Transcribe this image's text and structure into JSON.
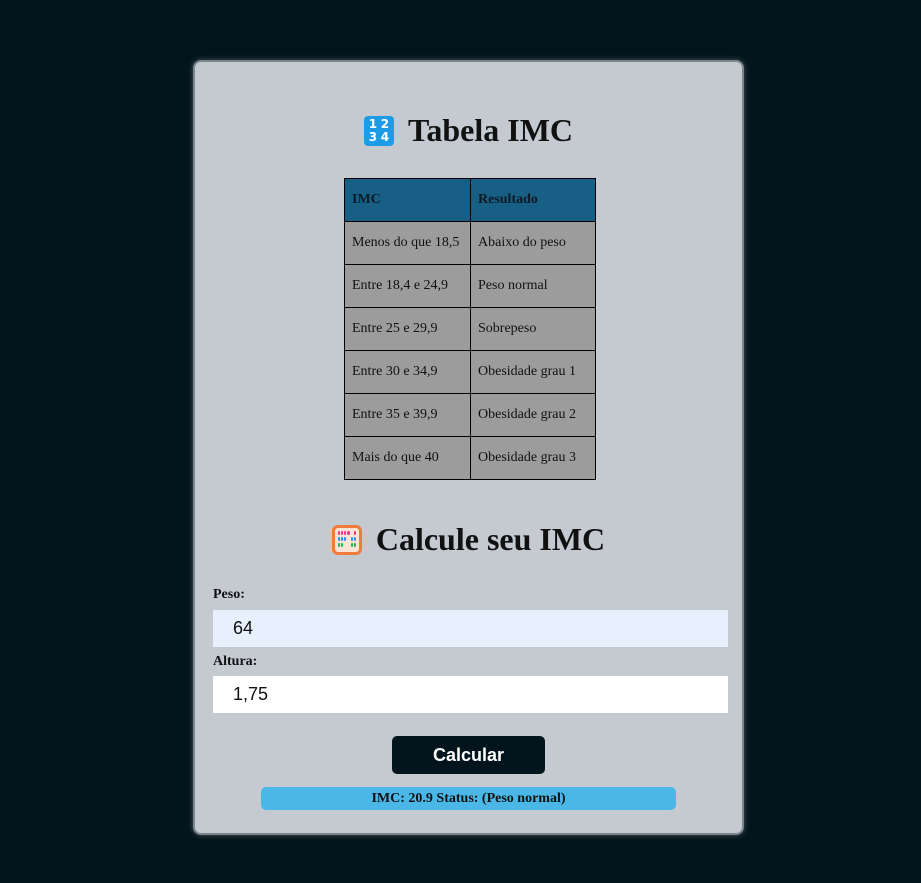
{
  "table_section": {
    "title": "Tabela IMC",
    "icon": "input-numbers-icon",
    "headers": [
      "IMC",
      "Resultado"
    ],
    "rows": [
      [
        "Menos do que 18,5",
        "Abaixo do peso"
      ],
      [
        "Entre 18,4 e 24,9",
        "Peso normal"
      ],
      [
        "Entre 25 e 29,9",
        "Sobrepeso"
      ],
      [
        "Entre 30 e 34,9",
        "Obesidade grau 1"
      ],
      [
        "Entre 35 e 39,9",
        "Obesidade grau 2"
      ],
      [
        "Mais do que 40",
        "Obesidade grau 3"
      ]
    ]
  },
  "calc_section": {
    "title": "Calcule seu IMC",
    "icon": "abacus-icon",
    "peso_label": "Peso:",
    "peso_value": "64",
    "altura_label": "Altura:",
    "altura_value": "1,75",
    "button_label": "Calcular",
    "result_text": "IMC: 20.9 Status: (Peso normal)"
  },
  "colors": {
    "background": "#03151c",
    "card": "#c5cad1",
    "table_header": "#185f86",
    "table_cell": "#9c9c9c",
    "button": "#03151c",
    "result": "#4bb7e6"
  }
}
